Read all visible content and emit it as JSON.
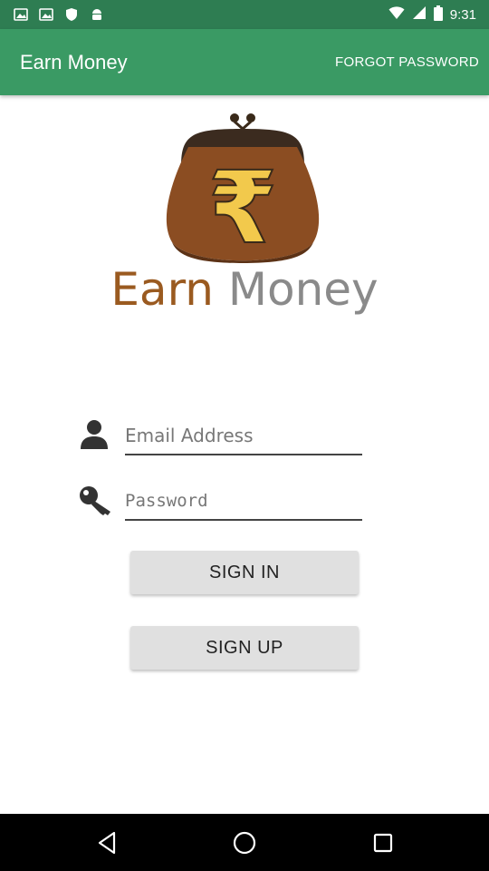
{
  "status_bar": {
    "time": "9:31",
    "icons": [
      "gallery-icon",
      "gallery-icon",
      "shield-icon",
      "android-icon",
      "wifi-icon",
      "signal-icon",
      "battery-icon"
    ]
  },
  "app_bar": {
    "title": "Earn Money",
    "forgot_label": "FORGOT PASSWORD"
  },
  "logo": {
    "symbol": "₹",
    "brand_word1": "Earn",
    "brand_word2": "Money"
  },
  "form": {
    "email_placeholder": "Email Address",
    "password_placeholder": "Password",
    "sign_in_label": "SIGN IN",
    "sign_up_label": "SIGN UP"
  },
  "colors": {
    "status_bar": "#2e7d52",
    "app_bar": "#3a9a64",
    "purse": "#8b4d22",
    "rupee": "#f2c94c"
  }
}
